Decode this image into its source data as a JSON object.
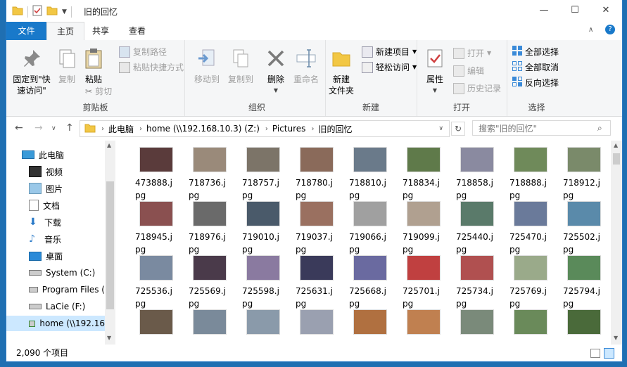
{
  "window": {
    "title": "旧的回忆",
    "controls": [
      "—",
      "☐",
      "✕"
    ]
  },
  "tabs": [
    {
      "label": "文件"
    },
    {
      "label": "主页"
    },
    {
      "label": "共享"
    },
    {
      "label": "查看"
    }
  ],
  "ribbon": {
    "clipboard": {
      "pin_label": "固定到\"快速访问\"",
      "copy_label": "复制",
      "paste_label": "粘贴",
      "copy_path_label": "复制路径",
      "paste_shortcut_label": "粘贴快捷方式",
      "cut_label": "剪切",
      "group_label": "剪贴板"
    },
    "organize": {
      "move_to_label": "移动到",
      "copy_to_label": "复制到",
      "delete_label": "删除",
      "rename_label": "重命名",
      "group_label": "组织"
    },
    "new": {
      "new_folder_label": "新建\n文件夹",
      "new_item_label": "新建项目",
      "easy_access_label": "轻松访问",
      "group_label": "新建"
    },
    "open": {
      "properties_label": "属性",
      "open_label": "打开",
      "edit_label": "编辑",
      "history_label": "历史记录",
      "group_label": "打开"
    },
    "select": {
      "select_all_label": "全部选择",
      "select_none_label": "全部取消",
      "invert_label": "反向选择",
      "group_label": "选择"
    }
  },
  "address": {
    "crumbs": [
      "此电脑",
      "home (\\\\192.168.10.3) (Z:)",
      "Pictures",
      "旧的回忆"
    ],
    "search_placeholder": "搜索\"旧的回忆\""
  },
  "nav": {
    "items": [
      {
        "label": "此电脑",
        "icon": "computer-icon"
      },
      {
        "label": "视频",
        "icon": "video-folder-icon"
      },
      {
        "label": "图片",
        "icon": "pictures-folder-icon"
      },
      {
        "label": "文档",
        "icon": "documents-folder-icon"
      },
      {
        "label": "下载",
        "icon": "download-folder-icon"
      },
      {
        "label": "音乐",
        "icon": "music-folder-icon"
      },
      {
        "label": "桌面",
        "icon": "desktop-folder-icon"
      },
      {
        "label": "System (C:)",
        "icon": "drive-icon"
      },
      {
        "label": "Program Files (",
        "icon": "drive-icon"
      },
      {
        "label": "LaCie (F:)",
        "icon": "drive-icon"
      },
      {
        "label": "home (\\\\192.16",
        "icon": "network-drive-icon"
      }
    ]
  },
  "files": [
    {
      "name": "473888.jpg",
      "color": "#5a3b3b"
    },
    {
      "name": "718736.jpg",
      "color": "#9a8a7a"
    },
    {
      "name": "718757.jpg",
      "color": "#7c7468"
    },
    {
      "name": "718780.jpg",
      "color": "#8a6a5a"
    },
    {
      "name": "718810.jpg",
      "color": "#6a7a8a"
    },
    {
      "name": "718834.jpg",
      "color": "#5f7a4a"
    },
    {
      "name": "718858.jpg",
      "color": "#8a8aa0"
    },
    {
      "name": "718888.jpg",
      "color": "#6f8a5a"
    },
    {
      "name": "718912.jpg",
      "color": "#7a8a6a"
    },
    {
      "name": "718945.jpg",
      "color": "#8a5050"
    },
    {
      "name": "718976.jpg",
      "color": "#6a6a6a"
    },
    {
      "name": "719010.jpg",
      "color": "#4a5a6a"
    },
    {
      "name": "719037.jpg",
      "color": "#9a7060"
    },
    {
      "name": "719066.jpg",
      "color": "#a0a0a0"
    },
    {
      "name": "719099.jpg",
      "color": "#b0a090"
    },
    {
      "name": "725440.jpg",
      "color": "#5a7a6a"
    },
    {
      "name": "725470.jpg",
      "color": "#6a7a9a"
    },
    {
      "name": "725502.jpg",
      "color": "#5a8aaa"
    },
    {
      "name": "725536.jpg",
      "color": "#7a8aa0"
    },
    {
      "name": "725569.jpg",
      "color": "#4a3a4a"
    },
    {
      "name": "725598.jpg",
      "color": "#8a7aa0"
    },
    {
      "name": "725631.jpg",
      "color": "#3a3a5a"
    },
    {
      "name": "725668.jpg",
      "color": "#6a6aa0"
    },
    {
      "name": "725701.jpg",
      "color": "#c04040"
    },
    {
      "name": "725734.jpg",
      "color": "#b05050"
    },
    {
      "name": "725769.jpg",
      "color": "#9aaa8a"
    },
    {
      "name": "725794.jpg",
      "color": "#5a8a5a"
    },
    {
      "name": "",
      "color": "#6a5a4a"
    },
    {
      "name": "",
      "color": "#7a8a9a"
    },
    {
      "name": "",
      "color": "#8a9aaa"
    },
    {
      "name": "",
      "color": "#9aa0b0"
    },
    {
      "name": "",
      "color": "#b07040"
    },
    {
      "name": "",
      "color": "#c08050"
    },
    {
      "name": "",
      "color": "#7a8a7a"
    },
    {
      "name": "",
      "color": "#6a8a5a"
    },
    {
      "name": "",
      "color": "#4a6a3a"
    }
  ],
  "status": {
    "count": "2,090 个项目"
  },
  "colors": {
    "accent": "#1979ca",
    "selection": "#cce8ff"
  }
}
